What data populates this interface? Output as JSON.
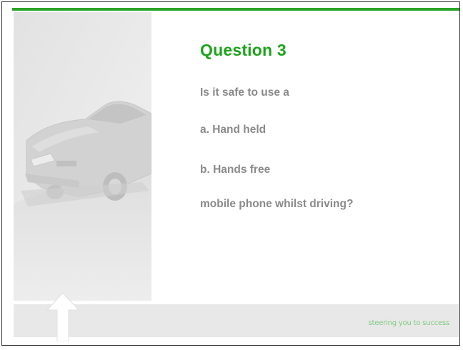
{
  "slide": {
    "title": "Question 3",
    "lines": [
      "Is it safe to use a",
      "a. Hand held",
      "b. Hands free",
      "mobile phone whilst driving?"
    ],
    "tagline": "steering you to success"
  },
  "colors": {
    "accent": "#2aa52a",
    "title": "#1ca31c",
    "body_text": "#8a8a8a",
    "tagline": "#7fc97f",
    "footer_band": "#e8e8e8"
  },
  "icons": {
    "photo": "car-photo-icon",
    "arrow": "up-arrow-icon"
  }
}
